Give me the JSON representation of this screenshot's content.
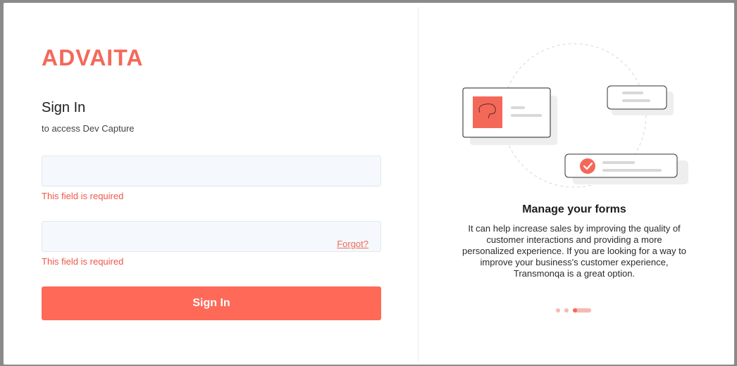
{
  "brand": "ADVAITA",
  "signin": {
    "title": "Sign In",
    "subtitle": "to access Dev Capture",
    "field1_error": "This field is required",
    "field2_error": "This field is required",
    "forgot": "Forgot?",
    "button": "Sign In"
  },
  "carousel": {
    "title": "Manage your forms",
    "description": "It can help increase sales by improving the quality of customer interactions and providing a more personalized experience. If you are looking for a way to improve your business's customer experience, Transmonqa is a great option.",
    "slides_total": 3,
    "active_slide": 3
  },
  "colors": {
    "accent": "#ff6957",
    "error": "#f0564a",
    "field_bg": "#f5f8fc"
  }
}
